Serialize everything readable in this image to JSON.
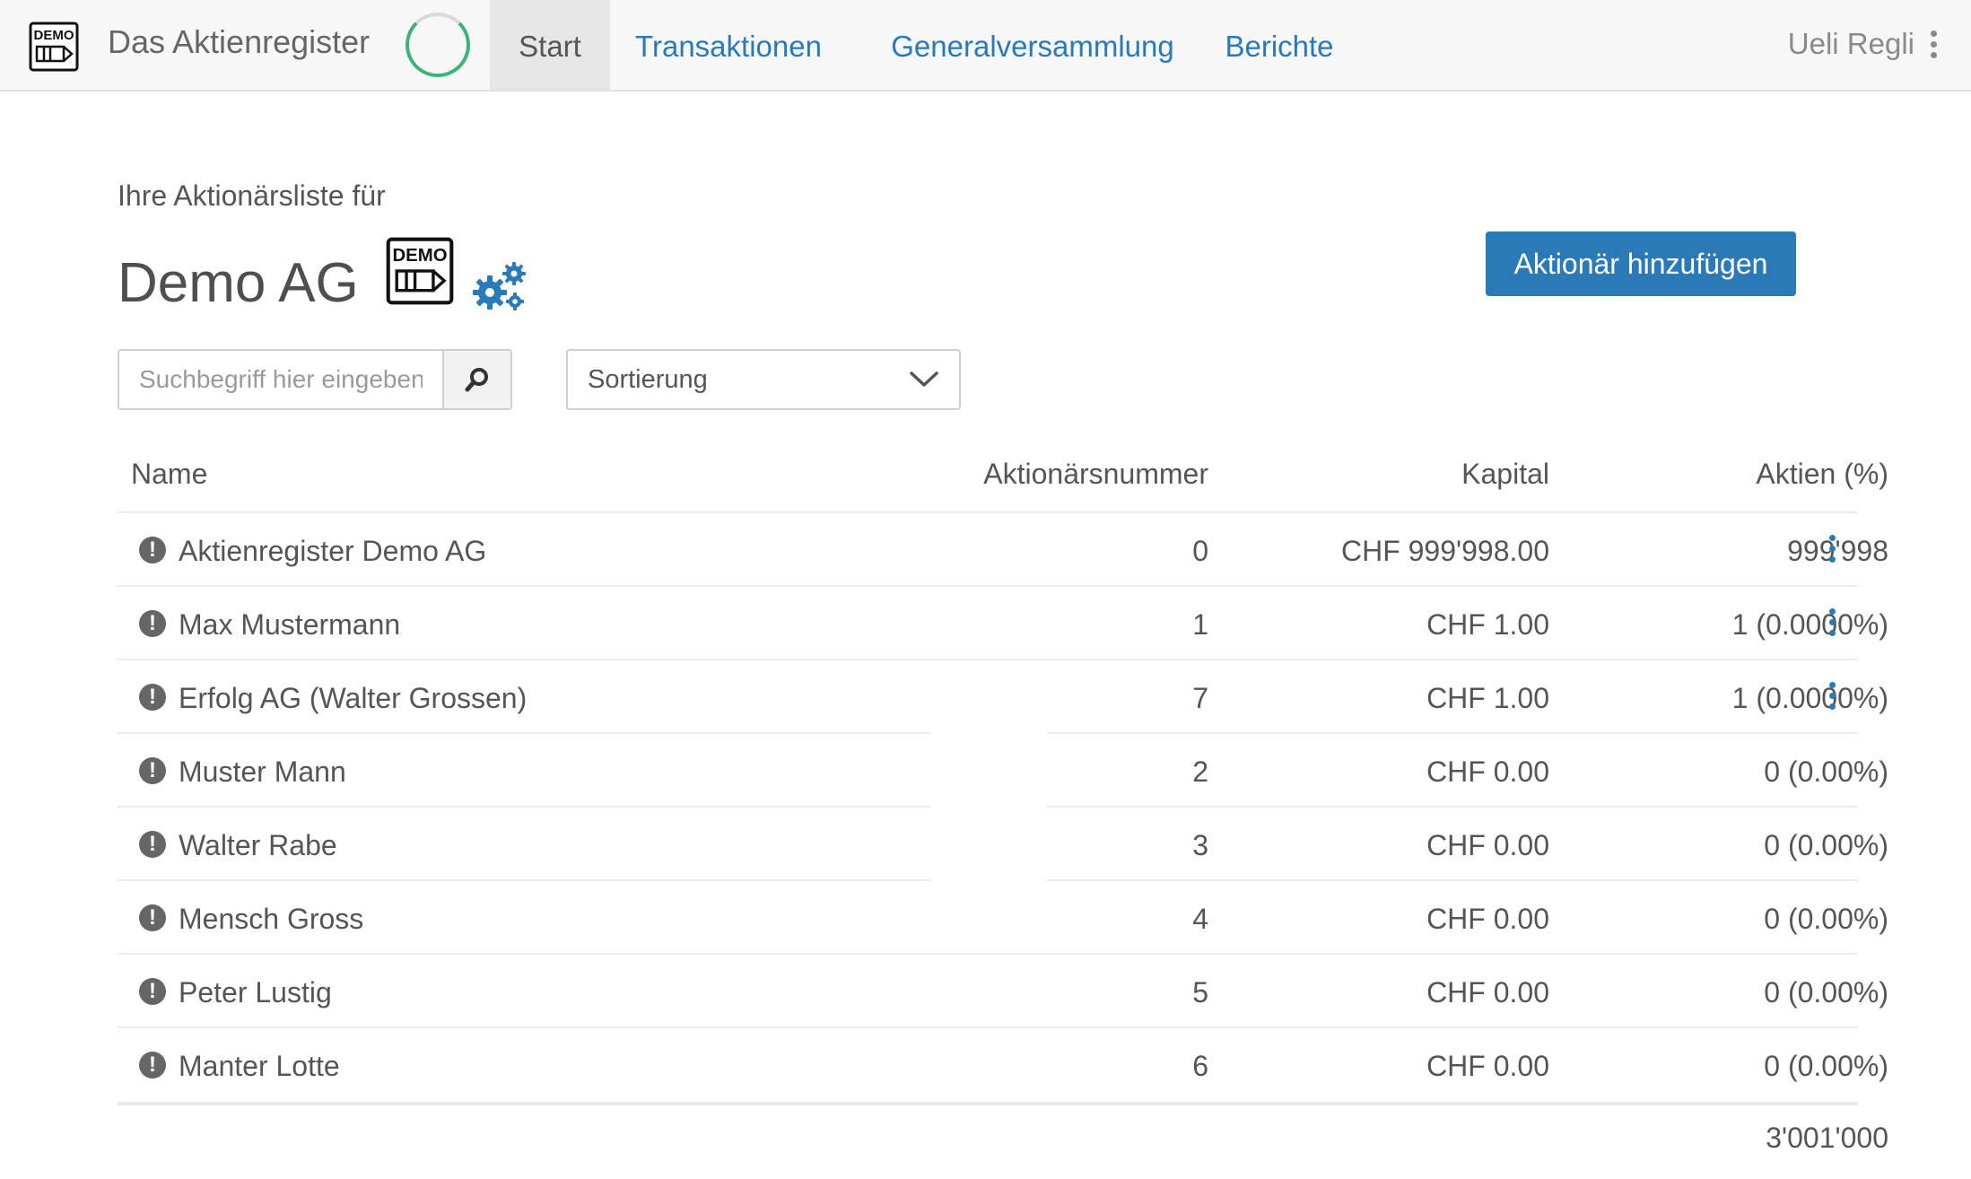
{
  "navbar": {
    "brand_title": "Das Aktienregister",
    "logo_text": "DEMO",
    "items": [
      {
        "label": "Start",
        "active": true
      },
      {
        "label": "Transaktionen",
        "active": false
      },
      {
        "label": "Generalversammlung",
        "active": false
      },
      {
        "label": "Berichte",
        "active": false
      }
    ],
    "user_name": "Ueli Regli"
  },
  "header": {
    "subtitle": "Ihre Aktionärsliste für",
    "company_name": "Demo AG",
    "logo_text": "DEMO",
    "settings_icon": "gears-icon",
    "add_button_label": "Aktionär hinzufügen"
  },
  "search": {
    "placeholder": "Suchbegriff hier eingeben",
    "value": "",
    "button_icon": "search-icon"
  },
  "sort": {
    "label": "Sortierung",
    "icon": "chevron-down-icon"
  },
  "table": {
    "columns": {
      "name": "Name",
      "number": "Aktionärsnummer",
      "capital": "Kapital",
      "shares": "Aktien (%)"
    },
    "rows": [
      {
        "name": "Aktienregister Demo AG",
        "number": "0",
        "capital": "CHF 999'998.00",
        "shares": "999'998",
        "menu": true
      },
      {
        "name": "Max Mustermann",
        "number": "1",
        "capital": "CHF 1.00",
        "shares": "1 (0.0000%)",
        "menu": true
      },
      {
        "name": "Erfolg AG (Walter Grossen)",
        "number": "7",
        "capital": "CHF 1.00",
        "shares": "1 (0.0000%)",
        "menu": true
      },
      {
        "name": "Muster Mann",
        "number": "2",
        "capital": "CHF 0.00",
        "shares": "0 (0.00%)",
        "menu": false
      },
      {
        "name": "Walter Rabe",
        "number": "3",
        "capital": "CHF 0.00",
        "shares": "0 (0.00%)",
        "menu": false
      },
      {
        "name": "Mensch Gross",
        "number": "4",
        "capital": "CHF 0.00",
        "shares": "0 (0.00%)",
        "menu": false
      },
      {
        "name": "Peter Lustig",
        "number": "5",
        "capital": "CHF 0.00",
        "shares": "0 (0.00%)",
        "menu": false
      },
      {
        "name": "Manter Lotte",
        "number": "6",
        "capital": "CHF 0.00",
        "shares": "0 (0.00%)",
        "menu": false
      }
    ],
    "total_shares": "3'001'000"
  },
  "colors": {
    "accent": "#2a7ab8",
    "spinner": "#3db27b",
    "navbar_bg": "#f7f7f7"
  }
}
